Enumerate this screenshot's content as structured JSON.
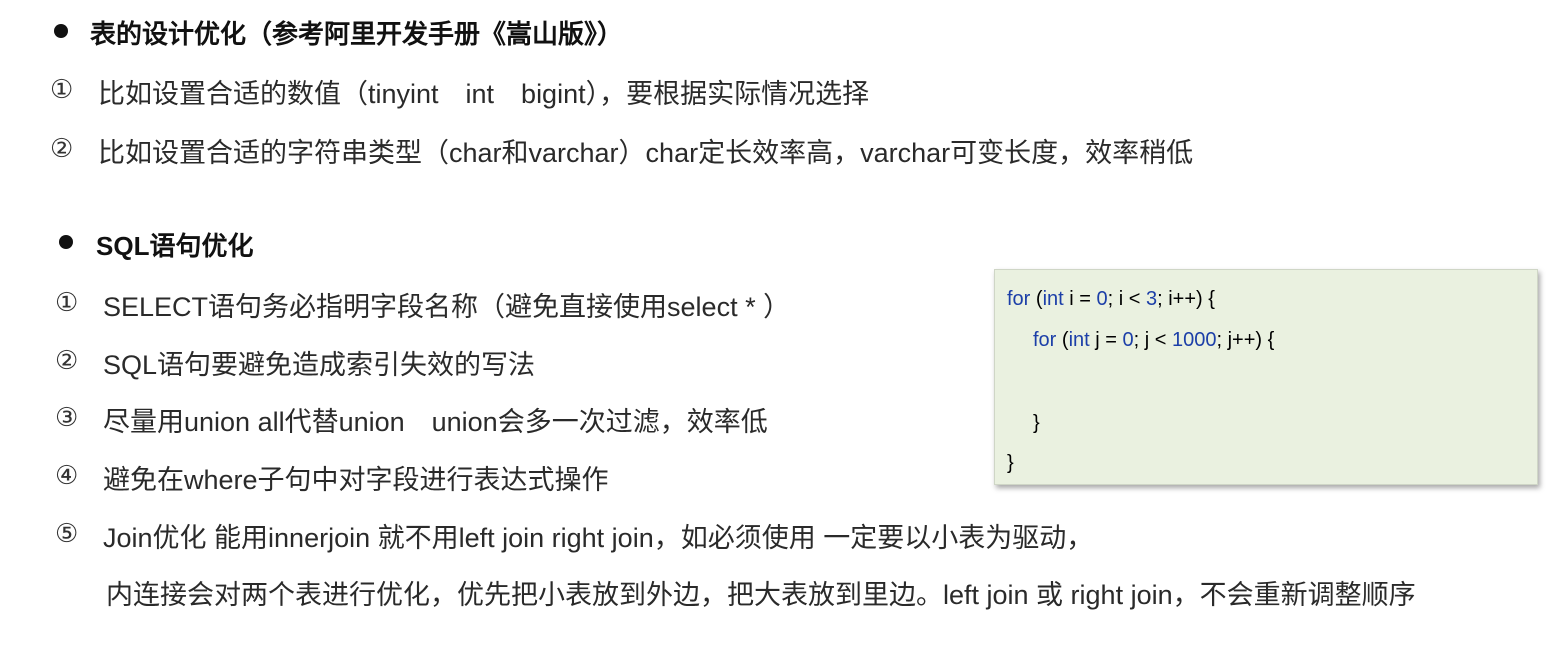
{
  "section1": {
    "heading": "表的设计优化（参考阿里开发手册《嵩山版》）",
    "items": [
      {
        "marker": "①",
        "text": "比如设置合适的数值（tinyint　int　bigint），要根据实际情况选择"
      },
      {
        "marker": "②",
        "text": "比如设置合适的字符串类型（char和varchar）char定长效率高，varchar可变长度，效率稍低"
      }
    ]
  },
  "section2": {
    "heading": "SQL语句优化",
    "items": [
      {
        "marker": "①",
        "text": "SELECT语句务必指明字段名称（避免直接使用select * ）"
      },
      {
        "marker": "②",
        "text": "SQL语句要避免造成索引失效的写法"
      },
      {
        "marker": "③",
        "text": "尽量用union all代替union　union会多一次过滤，效率低"
      },
      {
        "marker": "④",
        "text": "避免在where子句中对字段进行表达式操作"
      },
      {
        "marker": "⑤",
        "text": "Join优化 能用innerjoin 就不用left join right join，如必须使用 一定要以小表为驱动，"
      }
    ],
    "continuation": "内连接会对两个表进行优化，优先把小表放到外边，把大表放到里边。left join 或 right join，不会重新调整顺序"
  },
  "code": {
    "line1": {
      "kw1": "for",
      "p1": " (",
      "kw2": "int",
      "p2": " i = ",
      "n1": "0",
      "p3": "; i < ",
      "n2": "3",
      "p4": "; i++) {"
    },
    "line2": {
      "kw1": "for",
      "p1": " (",
      "kw2": "int",
      "p2": " j = ",
      "n1": "0",
      "p3": "; j < ",
      "n2": "1000",
      "p4": "; j++) {"
    },
    "line3": "}",
    "line4": "}"
  }
}
